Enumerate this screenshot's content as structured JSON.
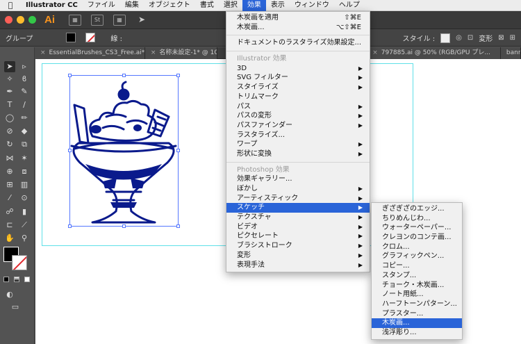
{
  "menubar": {
    "app": "Illustrator CC",
    "items": [
      "ファイル",
      "編集",
      "オブジェクト",
      "書式",
      "選択",
      "効果",
      "表示",
      "ウィンドウ",
      "ヘルプ"
    ],
    "active_index": 5
  },
  "appbar": {
    "logo": "Ai",
    "icon_label": "St"
  },
  "controlbar": {
    "group_label": "グループ",
    "stroke_label": "線 :",
    "style_label": "スタイル :",
    "transform_label": "変形"
  },
  "tabs": [
    "EssentialBrushes_CS3_Free.ai* @ ...",
    "名称未設定-1* @ 100% ...",
    "797885.ai @ 50% (RGB/GPU プレ...",
    "banne"
  ],
  "effects_menu": {
    "top_items": [
      {
        "label": "木炭画を適用",
        "shortcut": "⇧⌘E"
      },
      {
        "label": "木炭画...",
        "shortcut": "⌥⇧⌘E"
      }
    ],
    "doc_raster": "ドキュメントのラスタライズ効果設定...",
    "illustrator_header": "Illustrator 効果",
    "illustrator_items": [
      {
        "label": "3D",
        "sub": true
      },
      {
        "label": "SVG フィルター",
        "sub": true
      },
      {
        "label": "スタイライズ",
        "sub": true
      },
      {
        "label": "トリムマーク",
        "sub": false
      },
      {
        "label": "パス",
        "sub": true
      },
      {
        "label": "パスの変形",
        "sub": true
      },
      {
        "label": "パスファインダー",
        "sub": true
      },
      {
        "label": "ラスタライズ...",
        "sub": false
      },
      {
        "label": "ワープ",
        "sub": true
      },
      {
        "label": "形状に変換",
        "sub": true
      }
    ],
    "photoshop_header": "Photoshop 効果",
    "photoshop_items": [
      {
        "label": "効果ギャラリー...",
        "sub": false
      },
      {
        "label": "ぼかし",
        "sub": true
      },
      {
        "label": "アーティスティック",
        "sub": true
      },
      {
        "label": "スケッチ",
        "sub": true,
        "highlight": true
      },
      {
        "label": "テクスチャ",
        "sub": true
      },
      {
        "label": "ビデオ",
        "sub": true
      },
      {
        "label": "ピクセレート",
        "sub": true
      },
      {
        "label": "ブラシストローク",
        "sub": true
      },
      {
        "label": "変形",
        "sub": true
      },
      {
        "label": "表現手法",
        "sub": true
      }
    ]
  },
  "sketch_menu": {
    "items": [
      "ぎざぎざのエッジ...",
      "ちりめんじわ...",
      "ウォーターペーパー...",
      "クレヨンのコンテ画...",
      "クロム...",
      "グラフィックペン...",
      "コピー...",
      "スタンプ...",
      "チョーク・木炭画...",
      "ノート用紙...",
      "ハーフトーンパターン...",
      "プラスター...",
      "木炭画...",
      "浅浮彫り..."
    ],
    "highlight_index": 12
  },
  "colors": {
    "accent": "#2a64d8",
    "artboard": "#5ee0e8",
    "art": "#0a1a8c",
    "ai_orange": "#f7931e"
  }
}
